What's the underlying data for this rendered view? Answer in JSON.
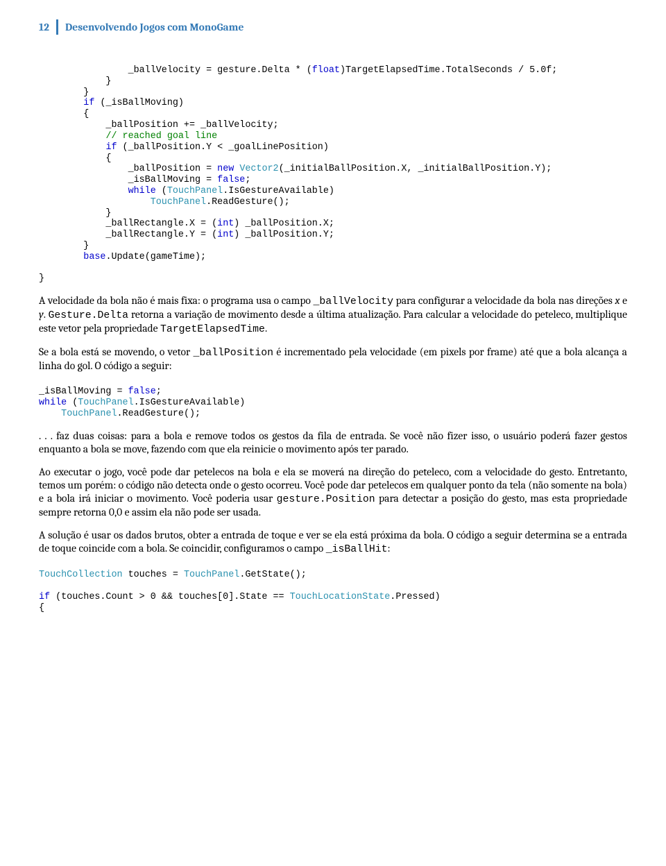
{
  "header": {
    "page_number": "12",
    "title": "Desenvolvendo Jogos com MonoGame"
  },
  "code1": {
    "l1_pre": "                _ballVelocity = gesture.Delta * (",
    "l1_kw": "float",
    "l1_post": ")TargetElapsedTime.TotalSeconds / 5.0f;",
    "l2": "            }",
    "l3": "        }",
    "l4_pre": "        ",
    "l4_kw": "if",
    "l4_post": " (_isBallMoving)",
    "l5": "        {",
    "l6": "            _ballPosition += _ballVelocity;",
    "l7_pre": "            ",
    "l7_cmt": "// reached goal line",
    "l8_pre": "            ",
    "l8_kw": "if",
    "l8_post": " (_ballPosition.Y < _goalLinePosition)",
    "l9": "            {",
    "l10_pre": "                _ballPosition = ",
    "l10_kw": "new",
    "l10_sp": " ",
    "l10_type": "Vector2",
    "l10_post": "(_initialBallPosition.X, _initialBallPosition.Y);",
    "l11_pre": "                _isBallMoving = ",
    "l11_kw": "false",
    "l11_post": ";",
    "l12_pre": "                ",
    "l12_kw": "while",
    "l12_post": " (",
    "l12_type": "TouchPanel",
    "l12_tail": ".IsGestureAvailable)",
    "l13_pre": "                    ",
    "l13_type": "TouchPanel",
    "l13_tail": ".ReadGesture();",
    "l14": "            }",
    "l15_pre": "            _ballRectangle.X = (",
    "l15_kw": "int",
    "l15_post": ") _ballPosition.X;",
    "l16_pre": "            _ballRectangle.Y = (",
    "l16_kw": "int",
    "l16_post": ") _ballPosition.Y;",
    "l17": "        }",
    "l18_pre": "        ",
    "l18_kw": "base",
    "l18_post": ".Update(gameTime);",
    "l19": "",
    "l20": "}"
  },
  "para1": {
    "s1": "A velocidade da bola não é mais fixa: o programa usa o campo ",
    "c1": "_ballVelocity",
    "s2": " para configurar a velocidade da bola nas direções ",
    "i1": "x",
    "s3": " e ",
    "i2": "y",
    "s4": ". ",
    "c2": "Gesture.Delta",
    "s5": " retorna a variação de movimento desde a última atualização. Para calcular a velocidade do peteleco, multiplique este vetor pela propriedade ",
    "c3": "TargetElapsedTime",
    "s6": "."
  },
  "para2": {
    "s1": "Se a bola está se movendo, o vetor ",
    "c1": "_ballPosition",
    "s2": " é incrementado pela velocidade (em pixels por frame) até que a bola alcança a linha do gol. O código a seguir:"
  },
  "code2": {
    "l1_pre": "_isBallMoving = ",
    "l1_kw": "false",
    "l1_post": ";",
    "l2_kw": "while",
    "l2_sp": " (",
    "l2_type": "TouchPanel",
    "l2_tail": ".IsGestureAvailable)",
    "l3_pre": "    ",
    "l3_type": "TouchPanel",
    "l3_tail": ".ReadGesture();"
  },
  "para3": ". . . faz duas coisas: para a bola e remove todos os gestos da fila de entrada. Se você não fizer isso, o usuário poderá fazer gestos enquanto a bola se move, fazendo com que ela reinicie o movimento após ter parado.",
  "para4": {
    "s1": "Ao executar o jogo, você pode dar petelecos na bola e ela se moverá na direção do peteleco, com a velocidade do gesto. Entretanto, temos um porém: o código não detecta onde o gesto ocorreu. Você pode dar petelecos em qualquer ponto da tela (não somente na bola) e a bola irá iniciar o movimento. Você poderia usar ",
    "c1": "gesture.Position",
    "s2": " para detectar a posição do gesto, mas esta propriedade sempre retorna 0,0 e assim ela não pode ser usada."
  },
  "para5": {
    "s1": "A solução é usar os dados brutos, obter a entrada de toque e ver se ela está próxima da bola. O código a seguir determina se a entrada de toque coincide com a bola. Se coincidir, configuramos o campo ",
    "c1": "_isBallHit",
    "s2": ":"
  },
  "code3": {
    "l1_type": "TouchCollection",
    "l1_mid": " touches = ",
    "l1_type2": "TouchPanel",
    "l1_tail": ".GetState();",
    "l2": "",
    "l3_kw": "if",
    "l3_mid": " (touches.Count > 0 && touches[0].State == ",
    "l3_type": "TouchLocationState",
    "l3_tail": ".Pressed)",
    "l4": "{"
  }
}
